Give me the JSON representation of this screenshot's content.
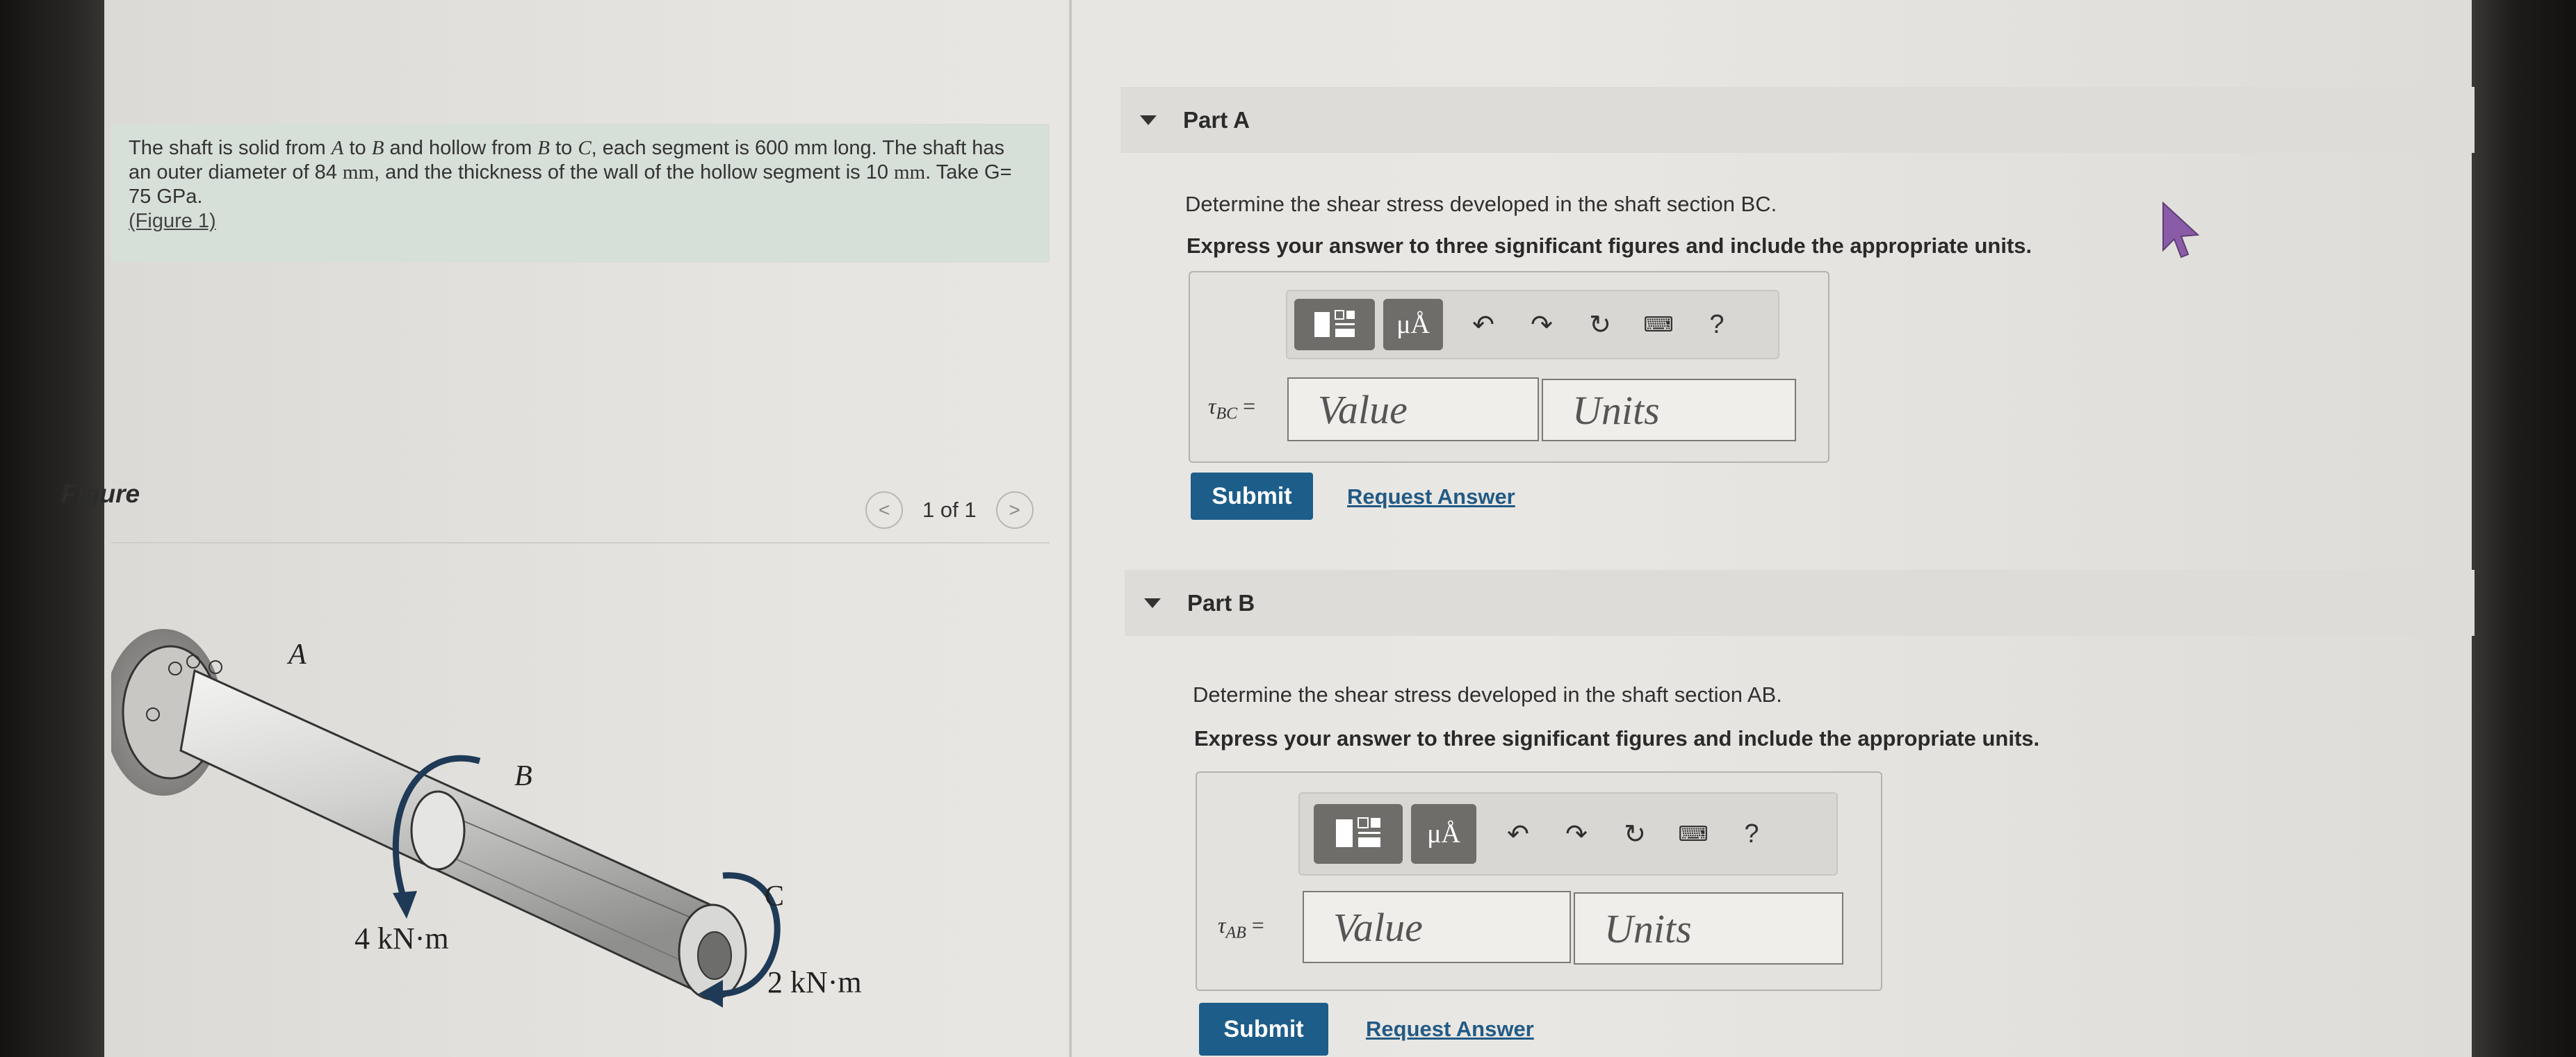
{
  "problem": {
    "line1_pre": "The shaft is solid from ",
    "A": "A",
    "to1": " to ",
    "B": "B",
    "line1_mid": " and hollow from ",
    "B2": "B",
    "to2": " to ",
    "C": "C",
    "line1_post": ", each segment is 600 mm long. The shaft has an outer diameter of 84 ",
    "mm1": "mm",
    "line2": ", and the thickness of the wall of the hollow segment is 10 ",
    "mm2": "mm",
    "line3": ". Take G= 75 GPa.",
    "figure_link": "(Figure 1)"
  },
  "figure": {
    "title": "Figure",
    "pager_text": "1 of 1",
    "prev": "<",
    "next": ">",
    "labels": {
      "A": "A",
      "B": "B",
      "C": "C",
      "torque_B": "4 kN·m",
      "torque_C": "2 kN·m"
    }
  },
  "partA": {
    "title": "Part A",
    "question": "Determine the shear stress developed in the shaft section BC.",
    "instruction": "Express your answer to three significant figures and include the appropriate units.",
    "tau": "τ",
    "sub": "BC",
    "eq": " =",
    "value_placeholder": "Value",
    "units_placeholder": "Units",
    "submit": "Submit",
    "request": "Request Answer"
  },
  "partB": {
    "title": "Part B",
    "question": "Determine the shear stress developed in the shaft section AB.",
    "instruction": "Express your answer to three significant figures and include the appropriate units.",
    "tau": "τ",
    "sub": "AB",
    "eq": " =",
    "value_placeholder": "Value",
    "units_placeholder": "Units",
    "submit": "Submit",
    "request": "Request Answer"
  },
  "toolbar": {
    "mu_label": "μÅ",
    "help": "?",
    "icons": [
      "templates-icon",
      "units-icon",
      "undo-icon",
      "redo-icon",
      "reset-icon",
      "keyboard-icon",
      "help-icon"
    ]
  }
}
